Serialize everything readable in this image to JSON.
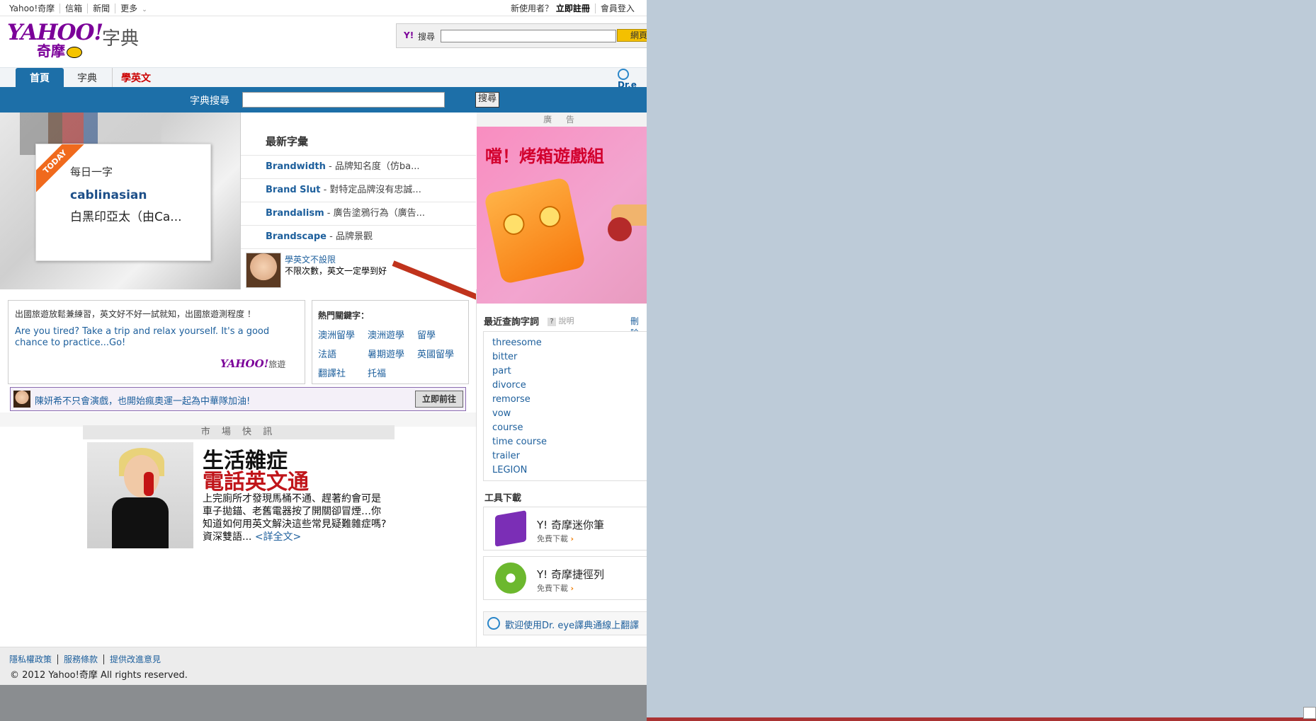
{
  "topbar": {
    "left": [
      "Yahoo!奇摩",
      "信箱",
      "新聞",
      "更多"
    ],
    "new_user": "新使用者？",
    "register": "立即註冊",
    "login": "會員登入"
  },
  "header": {
    "logo_text": "YAHOO!",
    "logo_sub": "奇摩",
    "title": "字典",
    "search_y": "Y!",
    "search_label": "搜尋",
    "search_button": "網頁"
  },
  "tabs": [
    "首頁",
    "字典",
    "學英文"
  ],
  "dreye": "Dr.e",
  "dict_search": {
    "label": "字典搜尋",
    "button": "搜尋"
  },
  "today": {
    "ribbon": "TODAY",
    "heading": "每日一字",
    "word": "cablinasian",
    "definition": "白黑印亞太（由Ca..."
  },
  "new_words": {
    "title": "最新字彙",
    "items": [
      {
        "word": "Brandwidth",
        "def": " - 品牌知名度（仿ba..."
      },
      {
        "word": "Brand Slut",
        "def": " - 對特定品牌沒有忠誠..."
      },
      {
        "word": "Brandalism",
        "def": " - 廣告塗鴉行為（廣告..."
      },
      {
        "word": "Brandscape",
        "def": " - 品牌景觀"
      }
    ],
    "promo_line1": "學英文不設限",
    "promo_line2": "不限次數，英文一定學到好"
  },
  "ad": {
    "label": "廣 告",
    "title": "噹！烤箱遊戲組"
  },
  "travel": {
    "line1": "出國旅遊放鬆兼練習，英文好不好一試就知，出國旅遊測程度 ！",
    "line2": "Are you tired? Take a trip and relax yourself. It's a good chance to practice...Go!",
    "logo": "YAHOO!",
    "logo_suffix": "旅遊"
  },
  "hot_keywords": {
    "title": "熱門關鍵字：",
    "items": [
      "澳洲留學",
      "澳洲遊學",
      "留學",
      "法語",
      "暑期遊學",
      "英國留學",
      "翻譯社",
      "托福"
    ]
  },
  "news_bar": {
    "text": "陳妍希不只會演戲，也開始瘋奧運一起為中華隊加油!",
    "button": "立即前往"
  },
  "market": {
    "label": "市 場 快 訊",
    "title1": "生活雜症",
    "title2": "電話英文通",
    "body": "上完廁所才發現馬桶不通、趕著約會可是車子拋錨、老舊電器按了開關卻冒煙…你知道如何用英文解決這些常見疑難雜症嗎?資深雙語...",
    "more": "<詳全文>"
  },
  "recent": {
    "title": "最近查詢字詞",
    "help": "說明",
    "delete": "刪除",
    "words": [
      "threesome",
      "bitter",
      "part",
      "divorce",
      "remorse",
      "vow",
      "course",
      "time course",
      "trailer",
      "LEGION"
    ]
  },
  "tools": {
    "title": "工具下載",
    "items": [
      {
        "name": "Y! 奇摩迷你筆",
        "desc": "免費下載"
      },
      {
        "name": "Y! 奇摩捷徑列",
        "desc": "免費下載"
      }
    ],
    "welcome": "歡迎使用Dr. eye譯典通線上翻譯"
  },
  "footer": {
    "links": [
      "隱私權政策",
      "服務條款",
      "提供改進意見"
    ],
    "copyright": "© 2012 Yahoo!奇摩 All rights reserved."
  },
  "colors": {
    "brand_purple": "#7b0099",
    "blue_bar": "#1d6fa8",
    "link_blue": "#1d5f9c",
    "accent_red": "#c0151a"
  }
}
